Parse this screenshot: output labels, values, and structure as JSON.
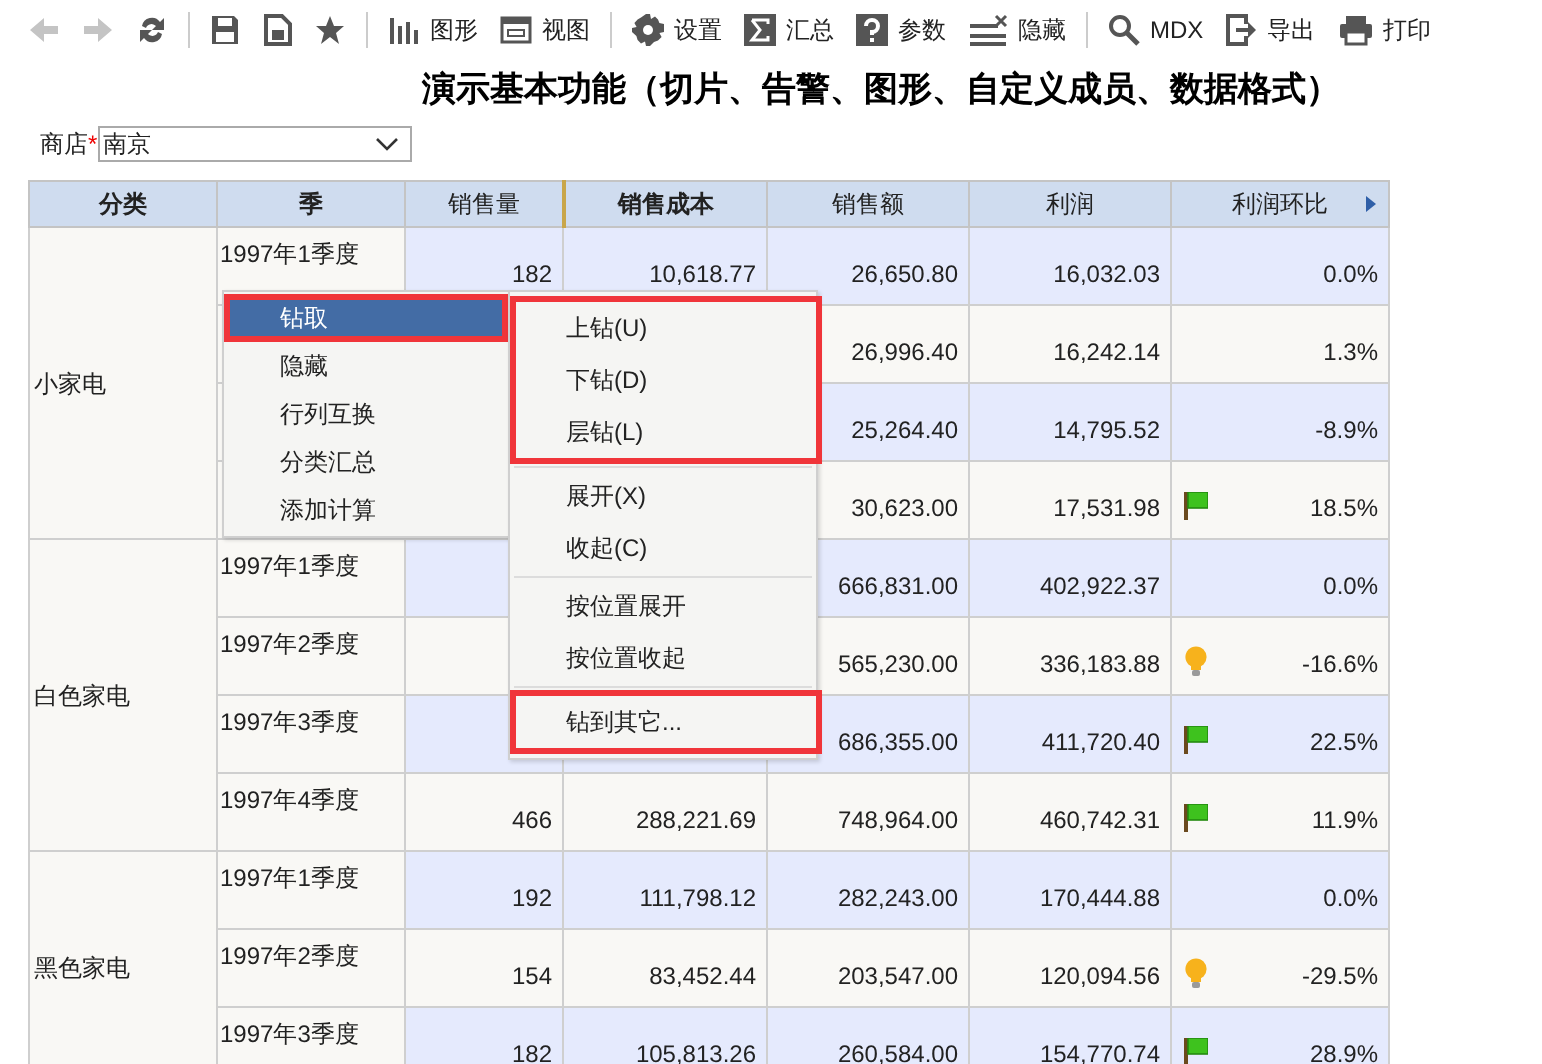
{
  "toolbar": [
    {
      "kind": "back",
      "disabled": true
    },
    {
      "kind": "forward",
      "disabled": true
    },
    {
      "kind": "refresh",
      "disabled": false
    },
    {
      "kind": "separator"
    },
    {
      "kind": "save",
      "disabled": false
    },
    {
      "kind": "save_as",
      "disabled": false
    },
    {
      "kind": "favorite",
      "disabled": false
    },
    {
      "kind": "separator"
    },
    {
      "kind": "chart",
      "label": "图形",
      "disabled": false
    },
    {
      "kind": "view",
      "label": "视图",
      "disabled": false
    },
    {
      "kind": "separator"
    },
    {
      "kind": "settings",
      "label": "设置",
      "disabled": false
    },
    {
      "kind": "sum",
      "label": "汇总",
      "disabled": false
    },
    {
      "kind": "params",
      "label": "参数",
      "disabled": false
    },
    {
      "kind": "hide",
      "label": "隐藏",
      "disabled": false
    },
    {
      "kind": "separator"
    },
    {
      "kind": "mdx",
      "label": "MDX",
      "disabled": false
    },
    {
      "kind": "export",
      "label": "导出",
      "disabled": false
    },
    {
      "kind": "print",
      "label": "打印",
      "disabled": false
    }
  ],
  "title": "演示基本功能（切片、告警、图形、自定义成员、数据格式）",
  "filter": {
    "label": "商店",
    "required": true,
    "required_mark": "*",
    "value": "南京"
  },
  "table": {
    "columns": [
      {
        "label": "分类",
        "bold": true
      },
      {
        "label": "季",
        "bold": true
      },
      {
        "label": "销售量",
        "bold": false
      },
      {
        "label": "销售成本",
        "bold": true
      },
      {
        "label": "销售额",
        "bold": false
      },
      {
        "label": "利润",
        "bold": false
      },
      {
        "label": "利润环比",
        "bold": false
      }
    ],
    "groups": [
      {
        "category": "小家电",
        "rows": [
          {
            "kind": "plain",
            "quarter": "1997年1季度",
            "quantity": "182",
            "cost": "10,618.77",
            "sales": "26,650.80",
            "profit": "16,032.03",
            "ratio": "0.0%"
          },
          {
            "kind": "plain",
            "sales": "26,996.40",
            "profit": "16,242.14",
            "ratio": "1.3%"
          },
          {
            "kind": "plain",
            "sales": "25,264.40",
            "profit": "14,795.52",
            "ratio": "-8.9%"
          },
          {
            "kind": "flag",
            "sales": "30,623.00",
            "profit": "17,531.98",
            "ratio": "18.5%"
          }
        ]
      },
      {
        "category": "白色家电",
        "rows": [
          {
            "kind": "plain",
            "quarter": "1997年1季度",
            "sales": "666,831.00",
            "profit": "402,922.37",
            "ratio": "0.0%"
          },
          {
            "kind": "bulb",
            "quarter": "1997年2季度",
            "sales": "565,230.00",
            "profit": "336,183.88",
            "ratio": "-16.6%"
          },
          {
            "kind": "flag",
            "quarter": "1997年3季度",
            "sales": "686,355.00",
            "profit": "411,720.40",
            "ratio": "22.5%"
          },
          {
            "kind": "flag",
            "quarter": "1997年4季度",
            "quantity": "466",
            "cost": "288,221.69",
            "sales": "748,964.00",
            "profit": "460,742.31",
            "ratio": "11.9%"
          }
        ]
      },
      {
        "category": "黑色家电",
        "rows": [
          {
            "kind": "plain",
            "quarter": "1997年1季度",
            "quantity": "192",
            "cost": "111,798.12",
            "sales": "282,243.00",
            "profit": "170,444.88",
            "ratio": "0.0%"
          },
          {
            "kind": "bulb",
            "quarter": "1997年2季度",
            "quantity": "154",
            "cost": "83,452.44",
            "sales": "203,547.00",
            "profit": "120,094.56",
            "ratio": "-29.5%"
          },
          {
            "kind": "flag",
            "quarter": "1997年3季度",
            "quantity": "182",
            "cost": "105,813.26",
            "sales": "260,584.00",
            "profit": "154,770.74",
            "ratio": "28.9%"
          }
        ]
      }
    ]
  },
  "context_menu": {
    "items": [
      {
        "label": "钻取",
        "selected": true,
        "outlined": true
      },
      {
        "label": "隐藏",
        "selected": false,
        "outlined": false
      },
      {
        "label": "行列互换",
        "selected": false,
        "outlined": false
      },
      {
        "label": "分类汇总",
        "selected": false,
        "outlined": false
      },
      {
        "label": "添加计算",
        "selected": false,
        "outlined": false
      }
    ]
  },
  "submenu": {
    "groups": [
      {
        "outlined": true,
        "items": [
          "上钻(U)",
          "下钻(D)",
          "层钻(L)"
        ]
      },
      {
        "outlined": false,
        "items": [
          "展开(X)",
          "收起(C)"
        ]
      },
      {
        "outlined": false,
        "items": [
          "按位置展开",
          "按位置收起"
        ]
      },
      {
        "outlined": true,
        "items": [
          "钻到其它..."
        ]
      }
    ]
  }
}
